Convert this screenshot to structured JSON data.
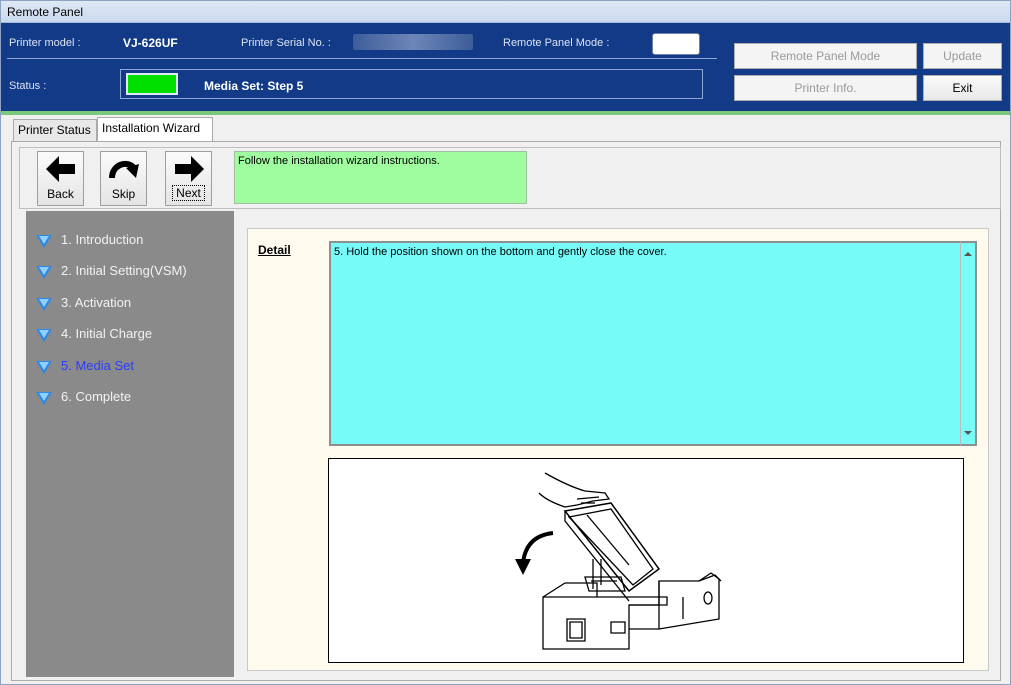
{
  "window": {
    "title": "Remote Panel"
  },
  "header": {
    "printer_model_label": "Printer model :",
    "printer_model_value": "VJ-626UF",
    "serial_label": "Printer Serial No. :",
    "remote_mode_label": "Remote Panel Mode :",
    "status_label": "Status :",
    "status_text": "Media Set: Step 5",
    "status_color": "#00e000",
    "buttons": {
      "remote_panel_mode": "Remote Panel Mode",
      "update": "Update",
      "printer_info": "Printer Info.",
      "exit": "Exit"
    }
  },
  "tabs": [
    {
      "label": "Printer Status"
    },
    {
      "label": "Installation Wizard"
    }
  ],
  "toolbar": {
    "back": "Back",
    "skip": "Skip",
    "next": "Next",
    "instruction": "Follow the installation wizard instructions."
  },
  "steps": [
    {
      "label": "1. Introduction"
    },
    {
      "label": "2. Initial Setting(VSM)"
    },
    {
      "label": "3. Activation"
    },
    {
      "label": "4. Initial Charge"
    },
    {
      "label": "5. Media Set"
    },
    {
      "label": "6. Complete"
    }
  ],
  "detail": {
    "label": "Detail",
    "text": "5. Hold the position shown on the bottom and gently close the cover."
  },
  "colors": {
    "header_bg": "#123a86",
    "current_step": "#2a3cff",
    "detail_bg": "#77fbf8",
    "instruction_bg": "#9ffc9f"
  }
}
